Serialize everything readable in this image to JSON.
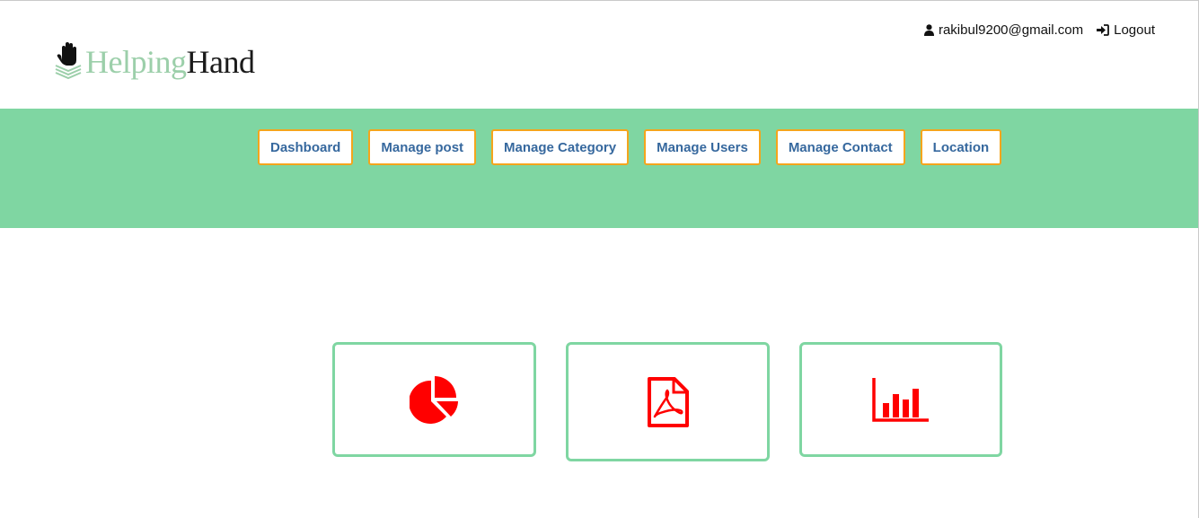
{
  "brand": {
    "name_part1": "Helping",
    "name_part2": "Hand",
    "logo_icon": "hand-stack-icon"
  },
  "user_bar": {
    "email": "rakibul9200@gmail.com",
    "logout_label": "Logout",
    "user_icon": "user-icon",
    "logout_icon": "sign-in-icon"
  },
  "nav": {
    "items": [
      {
        "label": "Dashboard"
      },
      {
        "label": "Manage post"
      },
      {
        "label": "Manage Category"
      },
      {
        "label": "Manage Users"
      },
      {
        "label": "Manage Contact"
      },
      {
        "label": "Location"
      }
    ]
  },
  "cards": [
    {
      "icon": "pie-chart-icon"
    },
    {
      "icon": "pdf-file-icon"
    },
    {
      "icon": "bar-chart-icon"
    }
  ],
  "colors": {
    "nav_band": "#7fd6a2",
    "nav_border": "#f4a51c",
    "nav_text": "#36689e",
    "card_border": "#7fd6a2",
    "icon_red": "#ff0000",
    "brand_light": "#9ccfaa"
  }
}
